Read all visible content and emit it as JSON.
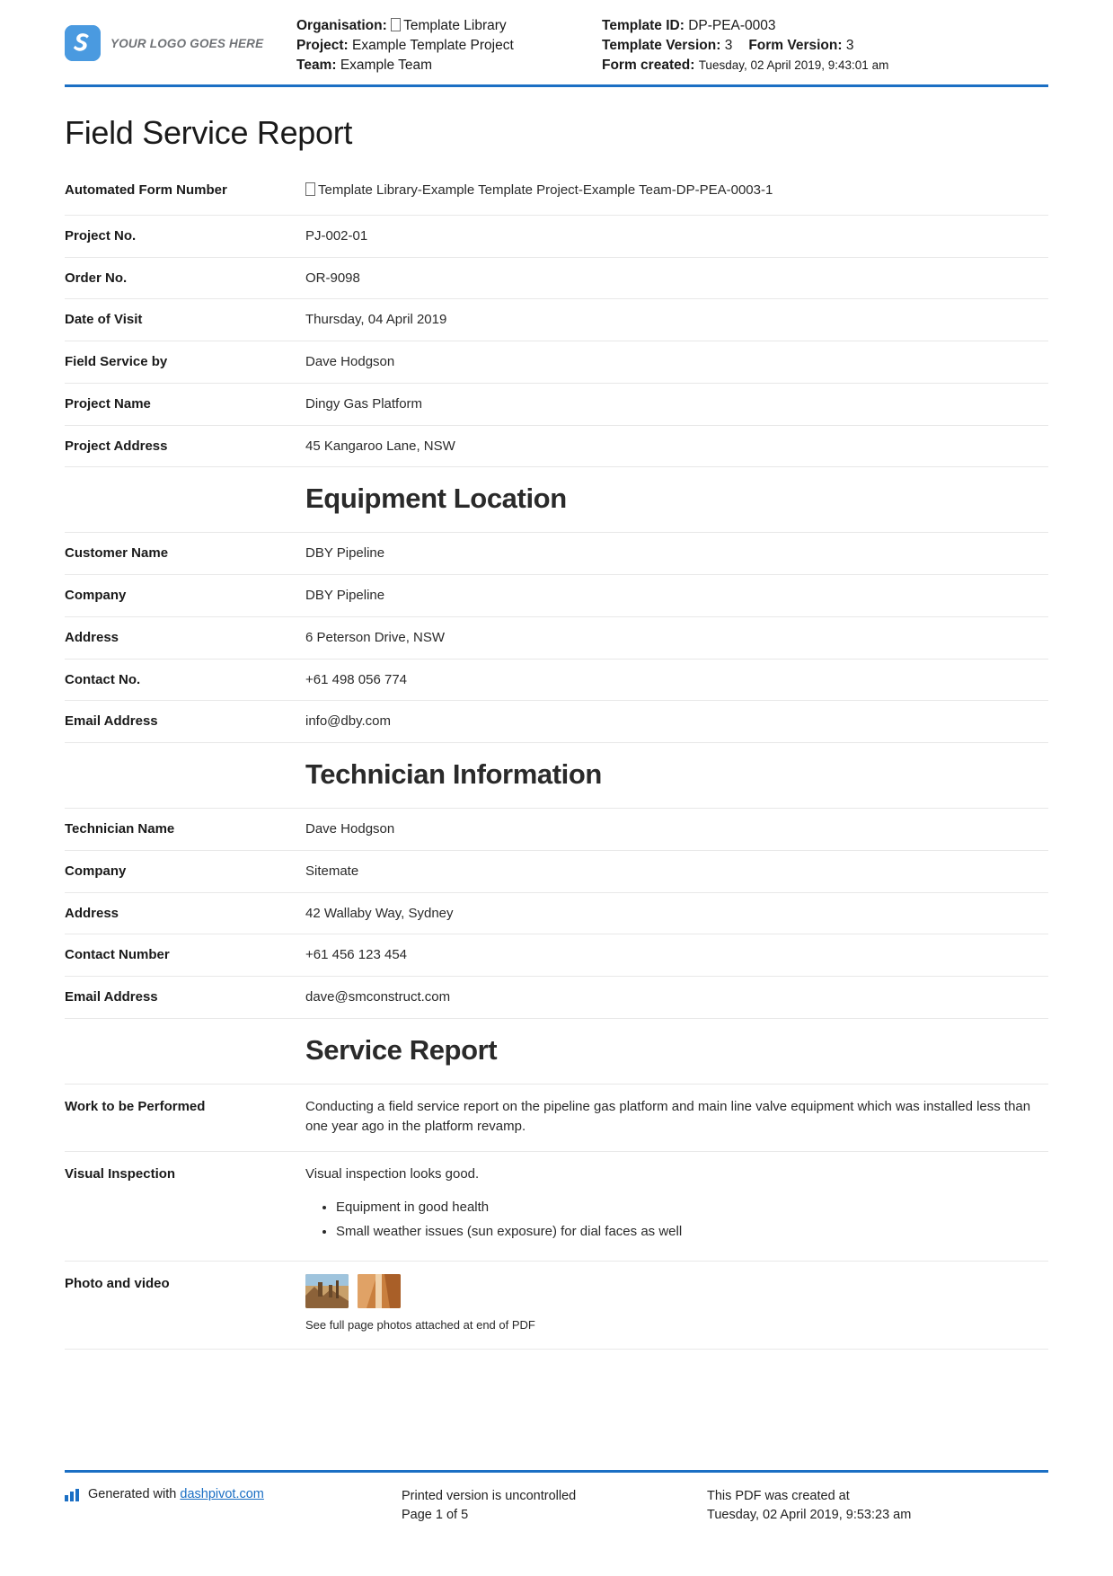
{
  "header": {
    "logo_text": "YOUR LOGO GOES HERE",
    "organisation_label": "Organisation:",
    "organisation_value": "Template Library",
    "project_label": "Project:",
    "project_value": "Example Template Project",
    "team_label": "Team:",
    "team_value": "Example Team",
    "template_id_label": "Template ID:",
    "template_id_value": "DP-PEA-0003",
    "template_version_label": "Template Version:",
    "template_version_value": "3",
    "form_version_label": "Form Version:",
    "form_version_value": "3",
    "form_created_label": "Form created:",
    "form_created_value": "Tuesday, 02 April 2019, 9:43:01 am"
  },
  "title": "Field Service Report",
  "sections": {
    "details": [
      {
        "label": "Automated Form Number",
        "value": "Template Library-Example Template Project-Example Team-DP-PEA-0003-1",
        "has_box_glyph": true
      },
      {
        "label": "Project No.",
        "value": "PJ-002-01"
      },
      {
        "label": "Order No.",
        "value": "OR-9098"
      },
      {
        "label": "Date of Visit",
        "value": "Thursday, 04 April 2019"
      },
      {
        "label": "Field Service by",
        "value": "Dave Hodgson"
      },
      {
        "label": "Project Name",
        "value": "Dingy Gas Platform"
      },
      {
        "label": "Project Address",
        "value": "45 Kangaroo Lane, NSW"
      }
    ],
    "equipment_location_title": "Equipment Location",
    "equipment_location": [
      {
        "label": "Customer Name",
        "value": "DBY Pipeline"
      },
      {
        "label": "Company",
        "value": "DBY Pipeline"
      },
      {
        "label": "Address",
        "value": "6 Peterson Drive, NSW"
      },
      {
        "label": "Contact No.",
        "value": "+61 498 056 774"
      },
      {
        "label": "Email Address",
        "value": "info@dby.com"
      }
    ],
    "technician_information_title": "Technician Information",
    "technician_information": [
      {
        "label": "Technician Name",
        "value": "Dave Hodgson"
      },
      {
        "label": "Company",
        "value": "Sitemate"
      },
      {
        "label": "Address",
        "value": "42 Wallaby Way, Sydney"
      },
      {
        "label": "Contact Number",
        "value": "+61 456 123 454"
      },
      {
        "label": "Email Address",
        "value": "dave@smconstruct.com"
      }
    ],
    "service_report_title": "Service Report",
    "service_report": {
      "work_label": "Work to be Performed",
      "work_value": "Conducting a field service report on the pipeline gas platform and main line valve equipment which was installed less than one year ago in the platform revamp.",
      "visual_label": "Visual Inspection",
      "visual_value": "Visual inspection looks good.",
      "visual_bullets": [
        "Equipment in good health",
        "Small weather issues (sun exposure) for dial faces as well"
      ],
      "photo_label": "Photo and video",
      "photo_caption": "See full page photos attached at end of PDF",
      "photo_count": 2
    }
  },
  "footer": {
    "generated_prefix": "Generated with",
    "generated_link": "dashpivot.com",
    "printed_line1": "Printed version is uncontrolled",
    "printed_line2": "Page 1 of 5",
    "created_line1": "This PDF was created at",
    "created_line2": "Tuesday, 02 April 2019, 9:53:23 am"
  },
  "colors": {
    "accent": "#1b6fc4",
    "logo": "#4a9ae0",
    "rule": "#e8e8e8"
  }
}
